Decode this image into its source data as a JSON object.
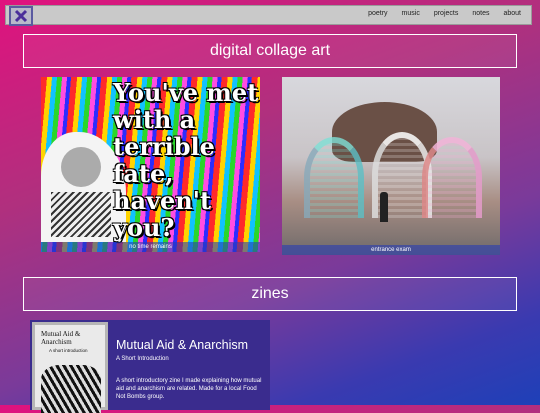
{
  "nav": {
    "items": [
      "poetry",
      "music",
      "projects",
      "notes",
      "about"
    ]
  },
  "sections": {
    "collage": {
      "title": "digital collage art"
    },
    "zines": {
      "title": "zines"
    }
  },
  "collage_items": [
    {
      "overlay_text": "You've met with a terrible fate, haven't you?",
      "caption": "no time remains"
    },
    {
      "caption": "entrance exam"
    }
  ],
  "zine": {
    "cover_title": "Mutual Aid & Anarchism",
    "cover_subtitle": "A short introduction",
    "title": "Mutual Aid & Anarchism",
    "subtitle": "A Short Introduction",
    "description": "A short introductory zine I made explaining how mutual aid and anarchism are related. Made for a local Food Not Bombs group."
  },
  "icons": {
    "logo": "close-x-icon"
  },
  "colors": {
    "accent": "#5a3fa0",
    "gradient_top": "#e0127e",
    "gradient_bottom": "#1e40b8"
  }
}
